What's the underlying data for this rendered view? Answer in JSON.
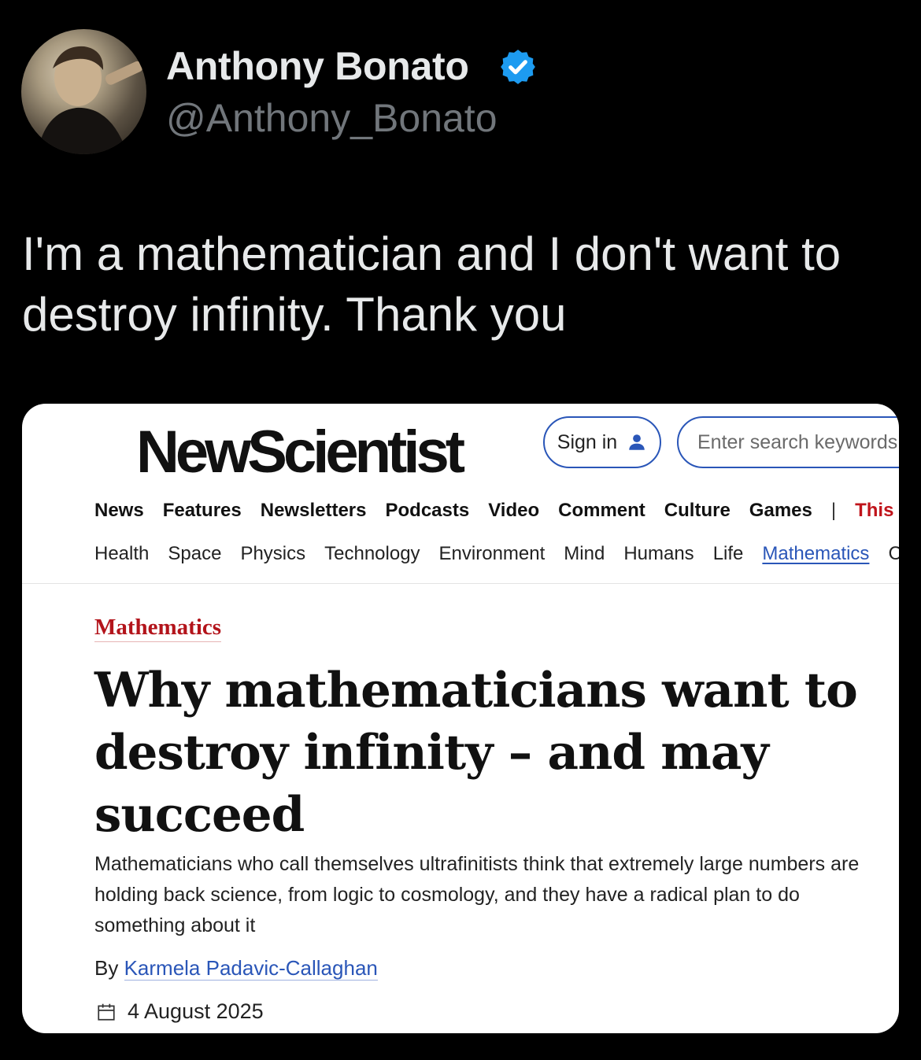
{
  "tweet": {
    "display_name": "Anthony Bonato",
    "handle": "@Anthony_Bonato",
    "text": "I'm a mathematician and I don't want to destroy infinity. Thank you",
    "verified_color": "#1d9bf0"
  },
  "article_card": {
    "site_logo": "NewScientist",
    "sign_in_label": "Sign in",
    "search_placeholder": "Enter search keywords",
    "primary_nav": [
      "News",
      "Features",
      "Newsletters",
      "Podcasts",
      "Video",
      "Comment",
      "Culture",
      "Games"
    ],
    "primary_nav_separator": "|",
    "primary_nav_highlight": "This v",
    "topic_nav": [
      "Health",
      "Space",
      "Physics",
      "Technology",
      "Environment",
      "Mind",
      "Humans",
      "Life",
      "Mathematics",
      "Ch"
    ],
    "topic_nav_active": "Mathematics",
    "category": "Mathematics",
    "headline": "Why mathematicians want to destroy infinity – and may succeed",
    "standfirst": "Mathematicians who call themselves ultrafinitists think that extremely large numbers are holding back science, from logic to cosmology, and they have a radical plan to do something about it",
    "byline_prefix": "By ",
    "author": "Karmela Padavic-Callaghan",
    "date": "4 August 2025",
    "accent_color": "#b3141b",
    "link_color": "#2a56b8"
  }
}
